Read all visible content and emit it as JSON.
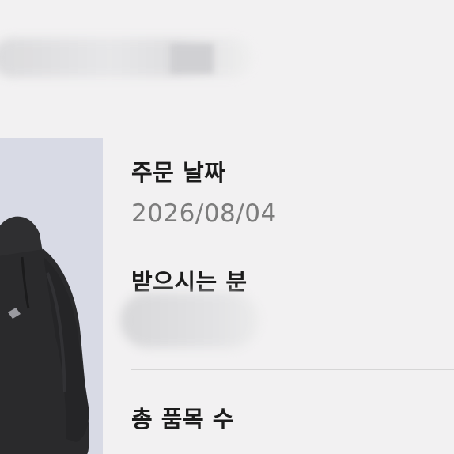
{
  "order_date": {
    "label": "주문 날짜",
    "value": "2026/08/04"
  },
  "recipient": {
    "label": "받으시는 분"
  },
  "total_items": {
    "label": "총 품목 수"
  },
  "colors": {
    "background": "#f2f1f2",
    "label_text": "#1c1c1c",
    "value_text": "#7c7c7c",
    "thumbnail_bg": "#d8dae5",
    "hoodie": "#2b2b2c"
  },
  "product_image": {
    "icon": "black-hoodie-image"
  }
}
